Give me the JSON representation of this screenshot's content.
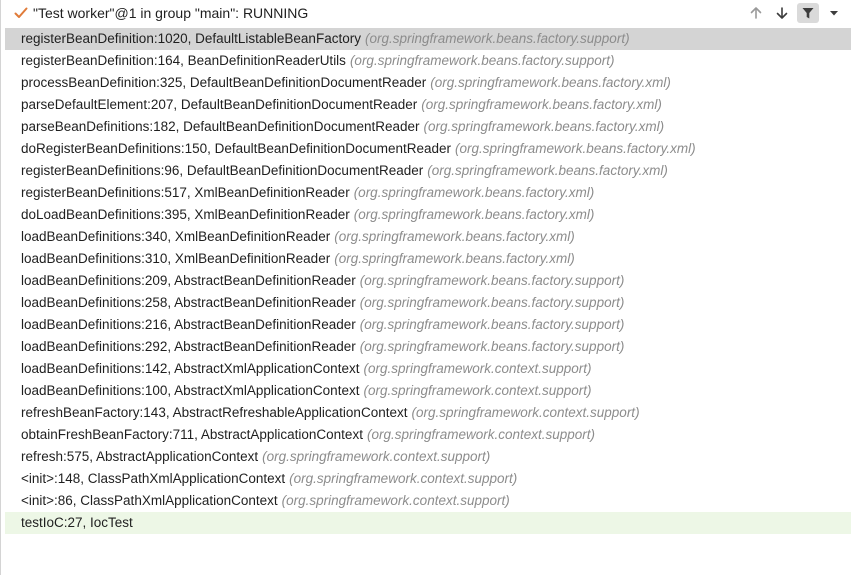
{
  "thread": {
    "title": "\"Test worker\"@1 in group \"main\": RUNNING",
    "status_icon": "check-icon",
    "status_color": "#e07b39"
  },
  "toolbar": {
    "buttons": [
      {
        "name": "move-up",
        "icon": "arrow-up-icon"
      },
      {
        "name": "move-down",
        "icon": "arrow-down-icon"
      },
      {
        "name": "filter",
        "icon": "filter-icon",
        "active": true
      },
      {
        "name": "more",
        "icon": "chevron-down-icon"
      }
    ]
  },
  "frames": [
    {
      "method": "registerBeanDefinition:1020, DefaultListableBeanFactory",
      "pkg": "(org.springframework.beans.factory.support)",
      "state": "selected"
    },
    {
      "method": "registerBeanDefinition:164, BeanDefinitionReaderUtils",
      "pkg": "(org.springframework.beans.factory.support)"
    },
    {
      "method": "processBeanDefinition:325, DefaultBeanDefinitionDocumentReader",
      "pkg": "(org.springframework.beans.factory.xml)"
    },
    {
      "method": "parseDefaultElement:207, DefaultBeanDefinitionDocumentReader",
      "pkg": "(org.springframework.beans.factory.xml)"
    },
    {
      "method": "parseBeanDefinitions:182, DefaultBeanDefinitionDocumentReader",
      "pkg": "(org.springframework.beans.factory.xml)"
    },
    {
      "method": "doRegisterBeanDefinitions:150, DefaultBeanDefinitionDocumentReader",
      "pkg": "(org.springframework.beans.factory.xml)"
    },
    {
      "method": "registerBeanDefinitions:96, DefaultBeanDefinitionDocumentReader",
      "pkg": "(org.springframework.beans.factory.xml)"
    },
    {
      "method": "registerBeanDefinitions:517, XmlBeanDefinitionReader",
      "pkg": "(org.springframework.beans.factory.xml)"
    },
    {
      "method": "doLoadBeanDefinitions:395, XmlBeanDefinitionReader",
      "pkg": "(org.springframework.beans.factory.xml)"
    },
    {
      "method": "loadBeanDefinitions:340, XmlBeanDefinitionReader",
      "pkg": "(org.springframework.beans.factory.xml)"
    },
    {
      "method": "loadBeanDefinitions:310, XmlBeanDefinitionReader",
      "pkg": "(org.springframework.beans.factory.xml)"
    },
    {
      "method": "loadBeanDefinitions:209, AbstractBeanDefinitionReader",
      "pkg": "(org.springframework.beans.factory.support)"
    },
    {
      "method": "loadBeanDefinitions:258, AbstractBeanDefinitionReader",
      "pkg": "(org.springframework.beans.factory.support)"
    },
    {
      "method": "loadBeanDefinitions:216, AbstractBeanDefinitionReader",
      "pkg": "(org.springframework.beans.factory.support)"
    },
    {
      "method": "loadBeanDefinitions:292, AbstractBeanDefinitionReader",
      "pkg": "(org.springframework.beans.factory.support)"
    },
    {
      "method": "loadBeanDefinitions:142, AbstractXmlApplicationContext",
      "pkg": "(org.springframework.context.support)"
    },
    {
      "method": "loadBeanDefinitions:100, AbstractXmlApplicationContext",
      "pkg": "(org.springframework.context.support)"
    },
    {
      "method": "refreshBeanFactory:143, AbstractRefreshableApplicationContext",
      "pkg": "(org.springframework.context.support)"
    },
    {
      "method": "obtainFreshBeanFactory:711, AbstractApplicationContext",
      "pkg": "(org.springframework.context.support)"
    },
    {
      "method": "refresh:575, AbstractApplicationContext",
      "pkg": "(org.springframework.context.support)"
    },
    {
      "method": "<init>:148, ClassPathXmlApplicationContext",
      "pkg": "(org.springframework.context.support)"
    },
    {
      "method": "<init>:86, ClassPathXmlApplicationContext",
      "pkg": "(org.springframework.context.support)"
    },
    {
      "method": "testIoC:27, IocTest",
      "pkg": "",
      "state": "current"
    }
  ],
  "colors": {
    "selected_row": "#d4d4d4",
    "current_row": "#edf7e6",
    "package_text": "#8c8c8c"
  }
}
